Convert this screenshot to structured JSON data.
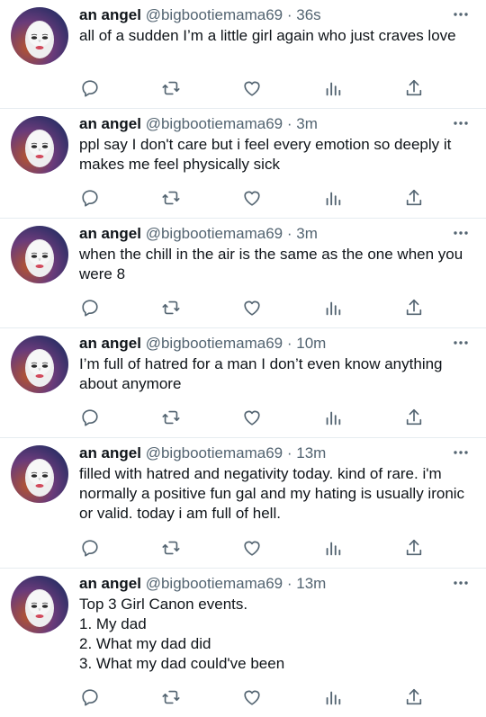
{
  "colors": {
    "text": "#0f1419",
    "secondary": "#536471",
    "divider": "#e6ecf0",
    "icon": "#536471"
  },
  "icons": [
    "reply-icon",
    "retweet-icon",
    "like-icon",
    "analytics-icon",
    "share-icon",
    "more-icon"
  ],
  "tweets": [
    {
      "name": "an angel",
      "handle": "@bigbootiemama69",
      "sep": "·",
      "time": "36s",
      "text": "all of a sudden I’m a little girl again who just craves love"
    },
    {
      "name": "an angel",
      "handle": "@bigbootiemama69",
      "sep": "·",
      "time": "3m",
      "text": "ppl say I don't care but i feel every emotion so deeply it makes me feel physically sick"
    },
    {
      "name": "an angel",
      "handle": "@bigbootiemama69",
      "sep": "·",
      "time": "3m",
      "text": "when the chill in the air is the same as the one when you were 8"
    },
    {
      "name": "an angel",
      "handle": "@bigbootiemama69",
      "sep": "·",
      "time": "10m",
      "text": "I’m full of hatred for a man I don’t even know anything about anymore"
    },
    {
      "name": "an angel",
      "handle": "@bigbootiemama69",
      "sep": "·",
      "time": "13m",
      "text": "filled with hatred and negativity today. kind of rare. i'm normally a positive fun gal and my hating is usually ironic or valid. today i am full of hell."
    },
    {
      "name": "an angel",
      "handle": "@bigbootiemama69",
      "sep": "·",
      "time": "13m",
      "text": "Top 3 Girl Canon events.\n1. My dad\n2. What my dad did\n3. What my dad could've been"
    }
  ]
}
